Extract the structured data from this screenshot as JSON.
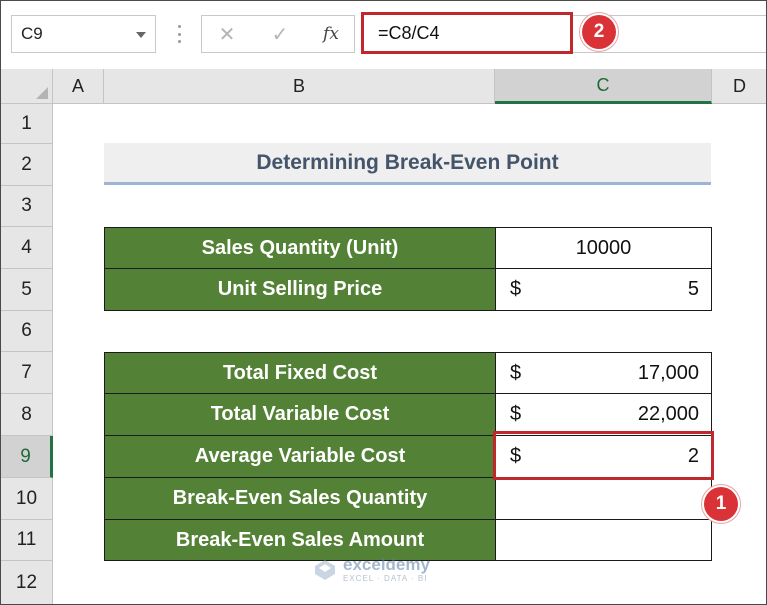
{
  "formula_bar": {
    "name_box": "C9",
    "cancel_glyph": "✕",
    "enter_glyph": "✓",
    "fx_label": "fx",
    "formula": "=C8/C4"
  },
  "badges": {
    "formula_step": "2",
    "cell_step": "1"
  },
  "columns": [
    "A",
    "B",
    "C",
    "D"
  ],
  "rows": [
    "1",
    "2",
    "3",
    "4",
    "5",
    "6",
    "7",
    "8",
    "9",
    "10",
    "11",
    "12"
  ],
  "sheet": {
    "title": "Determining Break-Even Point",
    "table1": [
      {
        "label": "Sales Quantity (Unit)",
        "currency": "",
        "value": "10000"
      },
      {
        "label": "Unit Selling Price",
        "currency": "$",
        "value": "5"
      }
    ],
    "table2": [
      {
        "label": "Total Fixed Cost",
        "currency": "$",
        "value": "17,000"
      },
      {
        "label": "Total Variable Cost",
        "currency": "$",
        "value": "22,000"
      },
      {
        "label": "Average Variable Cost",
        "currency": "$",
        "value": "2"
      },
      {
        "label": "Break-Even Sales Quantity",
        "currency": "",
        "value": ""
      },
      {
        "label": "Break-Even Sales Amount",
        "currency": "",
        "value": ""
      }
    ]
  },
  "watermark": {
    "name": "exceldemy",
    "tagline": "EXCEL · DATA · BI"
  },
  "colors": {
    "label_fill": "#538135",
    "highlight": "#c0282d",
    "selection": "#217346",
    "title_text": "#44546a"
  }
}
